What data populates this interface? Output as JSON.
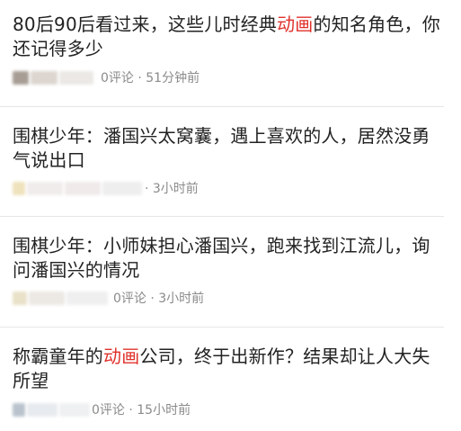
{
  "articles": [
    {
      "title_pre": "80后90后看过来，这些儿时经典",
      "title_hl": "动画",
      "title_post": "的知名角色，你还记得多少",
      "meta": "0评论 · 51分钟前"
    },
    {
      "title_pre": "围棋少年：潘国兴太窝囊，遇上喜欢的人，居然没勇气说出口",
      "title_hl": "",
      "title_post": "",
      "meta": "· 3小时前"
    },
    {
      "title_pre": "围棋少年：小师妹担心潘国兴，跑来找到江流儿，询问潘国兴的情况",
      "title_hl": "",
      "title_post": "",
      "meta": "0评论 · 3小时前"
    },
    {
      "title_pre": "称霸童年的",
      "title_hl": "动画",
      "title_post": "公司，终于出新作？结果却让人大失所望",
      "meta": "0评论 · 15小时前"
    }
  ],
  "colors": {
    "title": "#222222",
    "highlight": "#e0312b",
    "meta": "#8a8a8a",
    "divider": "#e6e6e6"
  }
}
